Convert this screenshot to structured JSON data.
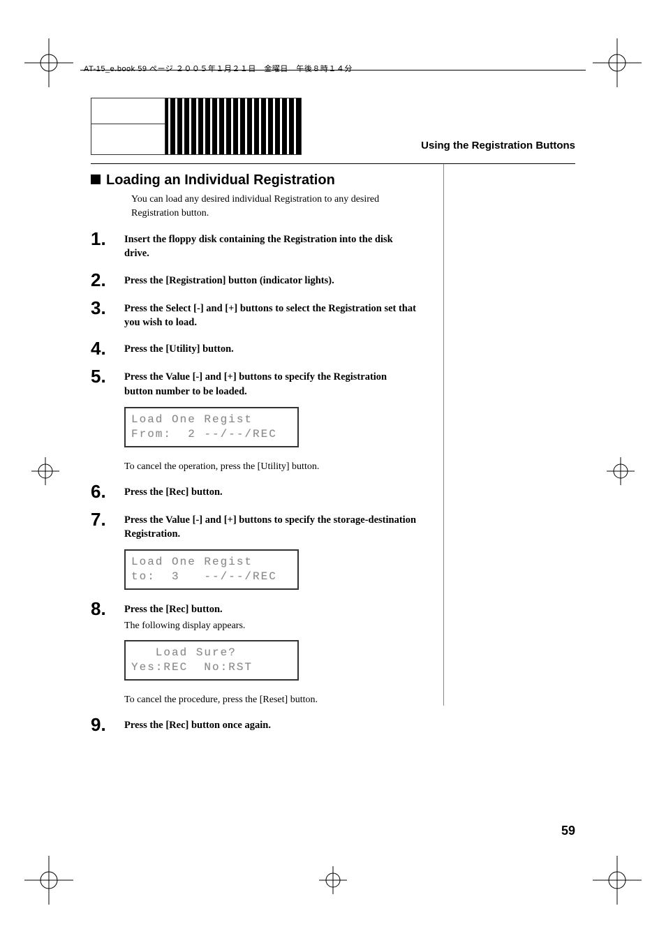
{
  "header_text": "AT-15_e.book 59 ページ ２００５年１月２１日　金曜日　午後８時１４分",
  "section_title": "Using the Registration Buttons",
  "heading": "Loading an Individual Registration",
  "intro": "You can load any desired individual Registration to any desired Registration button.",
  "steps": [
    {
      "num": "1",
      "text": "Insert the floppy disk containing the Registration into the disk drive."
    },
    {
      "num": "2",
      "text": "Press the [Registration] button (indicator lights)."
    },
    {
      "num": "3",
      "text": "Press the Select [-] and [+] buttons to select the Registration set that you wish to load."
    },
    {
      "num": "4",
      "text": "Press the [Utility] button."
    },
    {
      "num": "5",
      "text": "Press the Value [-] and [+] buttons to specify the Registration button number to be loaded."
    },
    {
      "num": "6",
      "text": "Press the [Rec] button."
    },
    {
      "num": "7",
      "text": "Press the Value [-] and [+] buttons to specify the storage-destination Registration."
    },
    {
      "num": "8",
      "text": "Press the [Rec] button."
    },
    {
      "num": "9",
      "text": "Press the [Rec] button once again."
    }
  ],
  "lcd1": {
    "line1": "Load One Regist",
    "line2": "From:  2 --/--/REC"
  },
  "cancel1": "To cancel the operation, press the [Utility] button.",
  "lcd2": {
    "line1": "Load One Regist",
    "line2": "to:  3   --/--/REC"
  },
  "following_display": "The following display appears.",
  "lcd3": {
    "line1": "   Load Sure?",
    "line2": "Yes:REC  No:RST"
  },
  "cancel2": "To cancel the procedure, press the [Reset] button.",
  "page_number": "59"
}
